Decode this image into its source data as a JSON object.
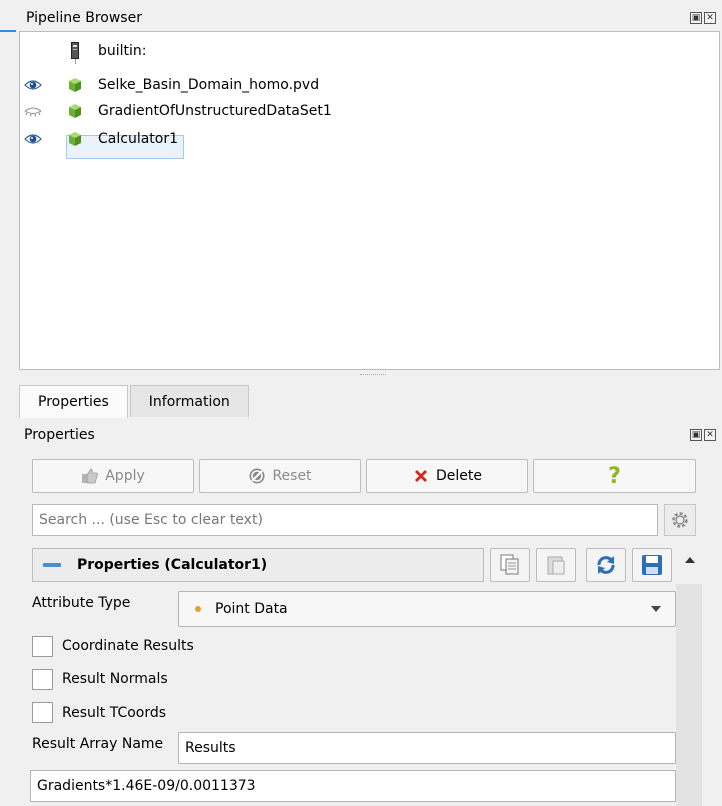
{
  "pipeline_browser": {
    "title": "Pipeline Browser",
    "items": [
      {
        "label": "builtin:",
        "visible": null
      },
      {
        "label": "Selke_Basin_Domain_homo.pvd",
        "visible": true
      },
      {
        "label": "GradientOfUnstructuredDataSet1",
        "visible": false
      },
      {
        "label": "Calculator1",
        "visible": true,
        "selected": true
      }
    ]
  },
  "tabs": [
    {
      "label": "Properties",
      "active": true
    },
    {
      "label": "Information",
      "active": false
    }
  ],
  "properties_panel": {
    "title": "Properties",
    "toolbar": {
      "apply_label": "Apply",
      "reset_label": "Reset",
      "delete_label": "Delete",
      "help_label": "?"
    },
    "search": {
      "placeholder": "Search ... (use Esc to clear text)"
    },
    "section": {
      "title": "Properties (Calculator1)"
    },
    "attribute_type": {
      "label": "Attribute Type",
      "value": "Point Data"
    },
    "checkboxes": [
      {
        "label": "Coordinate Results",
        "checked": false
      },
      {
        "label": "Result Normals",
        "checked": false
      },
      {
        "label": "Result TCoords",
        "checked": false
      }
    ],
    "result_array_name": {
      "label": "Result Array Name",
      "value": "Results"
    },
    "expression": {
      "value": "Gradients*1.46E-09/0.0011373"
    }
  },
  "colors": {
    "accent": "#3b8ad9",
    "delete_x": "#d9261c",
    "help": "#8fb520",
    "cube": "#7fbf3f",
    "selection": "#eaf3fc"
  }
}
